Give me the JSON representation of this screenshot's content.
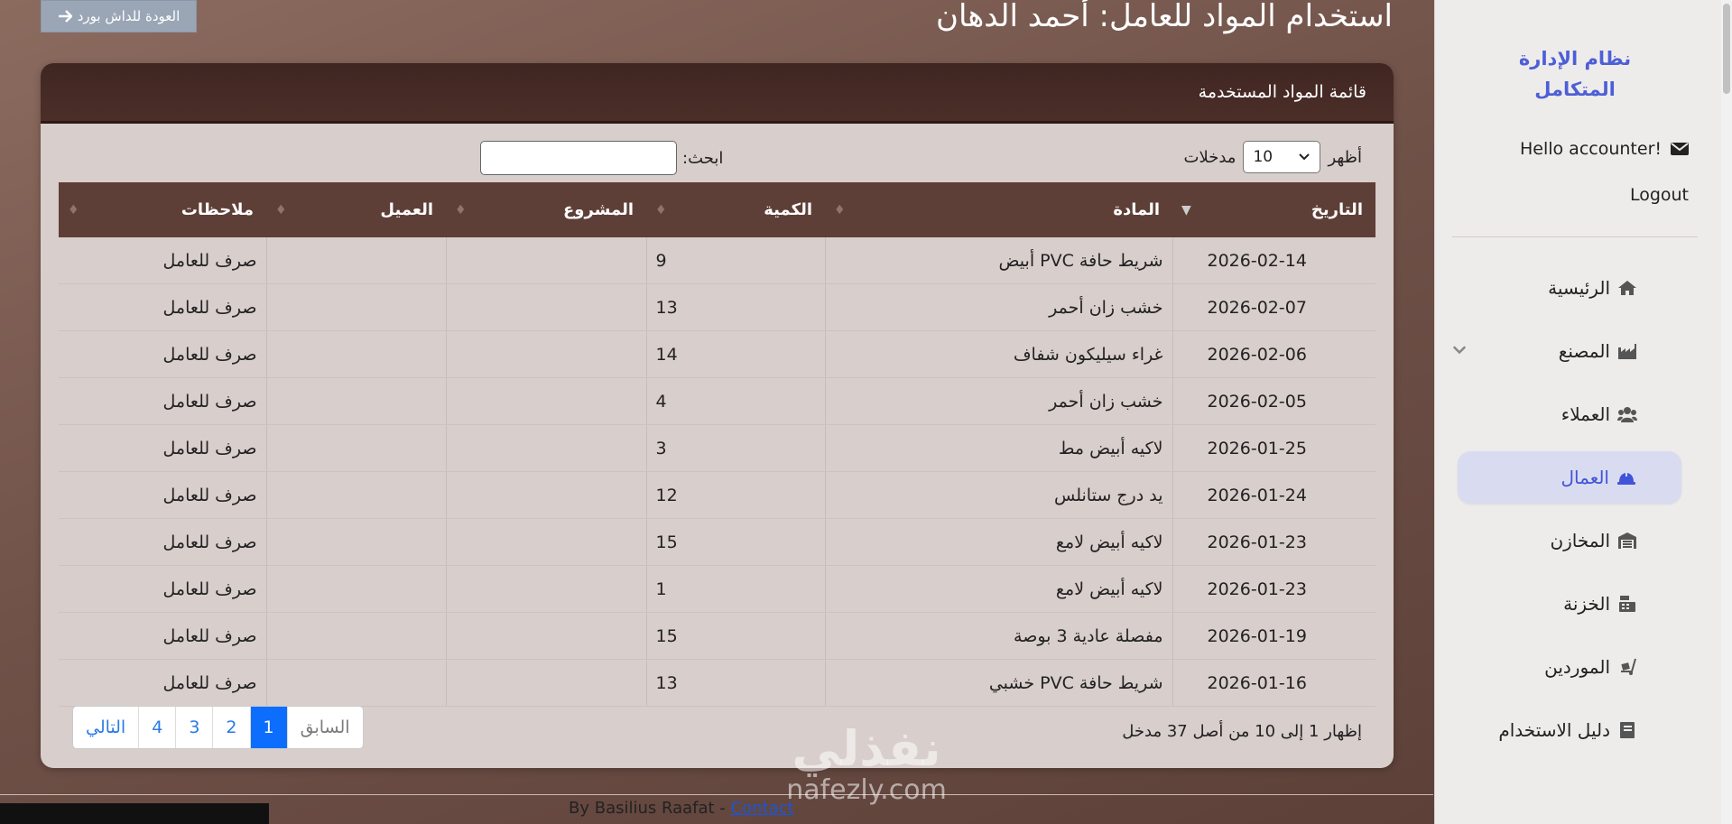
{
  "back_button": {
    "label": "العودة للداش بورد"
  },
  "page_title": "استخدام المواد للعامل: أحمد الدهان",
  "card_title": "قائمة المواد المستخدمة",
  "controls": {
    "show_label": "أظهر",
    "entries_value": "10",
    "entries_label": "مدخلات",
    "search_label": "ابحث:",
    "search_value": ""
  },
  "table": {
    "headers": [
      "التاريخ",
      "المادة",
      "الكمية",
      "المشروع",
      "العميل",
      "ملاحظات"
    ],
    "rows": [
      {
        "date": "2026-02-14",
        "item": "شريط حافة PVC أبيض",
        "qty": "9",
        "project": "",
        "client": "",
        "note": "صرف للعامل"
      },
      {
        "date": "2026-02-07",
        "item": "خشب زان أحمر",
        "qty": "13",
        "project": "",
        "client": "",
        "note": "صرف للعامل"
      },
      {
        "date": "2026-02-06",
        "item": "غراء سيليكون شفاف",
        "qty": "14",
        "project": "",
        "client": "",
        "note": "صرف للعامل"
      },
      {
        "date": "2026-02-05",
        "item": "خشب زان أحمر",
        "qty": "4",
        "project": "",
        "client": "",
        "note": "صرف للعامل"
      },
      {
        "date": "2026-01-25",
        "item": "لاكيه أبيض مط",
        "qty": "3",
        "project": "",
        "client": "",
        "note": "صرف للعامل"
      },
      {
        "date": "2026-01-24",
        "item": "يد درج ستانلس",
        "qty": "12",
        "project": "",
        "client": "",
        "note": "صرف للعامل"
      },
      {
        "date": "2026-01-23",
        "item": "لاكيه أبيض لامع",
        "qty": "15",
        "project": "",
        "client": "",
        "note": "صرف للعامل"
      },
      {
        "date": "2026-01-23",
        "item": "لاكيه أبيض لامع",
        "qty": "1",
        "project": "",
        "client": "",
        "note": "صرف للعامل"
      },
      {
        "date": "2026-01-19",
        "item": "مفصلة عادية 3 بوصة",
        "qty": "15",
        "project": "",
        "client": "",
        "note": "صرف للعامل"
      },
      {
        "date": "2026-01-16",
        "item": "شريط حافة PVC خشبي",
        "qty": "13",
        "project": "",
        "client": "",
        "note": "صرف للعامل"
      }
    ]
  },
  "info_text": "إظهار 1 إلى 10 من أصل 37 مدخل",
  "pagination": {
    "prev": "السابق",
    "pages": [
      "1",
      "2",
      "3",
      "4"
    ],
    "active_page": "1",
    "next": "التالي"
  },
  "sidebar": {
    "brand": "نظام الإدارة المتكامل",
    "greeting": "Hello accounter!",
    "logout": "Logout",
    "items": [
      {
        "label": "الرئيسية",
        "icon": "home-icon"
      },
      {
        "label": "المصنع",
        "icon": "industry-icon"
      },
      {
        "label": "العملاء",
        "icon": "users-icon"
      },
      {
        "label": "العمال",
        "icon": "hard-hat-icon"
      },
      {
        "label": "المخازن",
        "icon": "warehouse-icon"
      },
      {
        "label": "الخزنة",
        "icon": "cash-register-icon"
      },
      {
        "label": "الموردين",
        "icon": "dolly-icon"
      },
      {
        "label": "دليل الاستخدام",
        "icon": "book-icon"
      }
    ],
    "active_item": "العمال"
  },
  "footer": {
    "text": "By Basilius Raafat - ",
    "link": "Contact"
  },
  "watermark": {
    "arabic": "نفذلي",
    "latin": "nafezly.com"
  },
  "colors": {
    "accent": "#4d5fd6",
    "card_header": "#3f2622",
    "table_header": "#5e3f37",
    "active_page": "#0d6efd"
  }
}
